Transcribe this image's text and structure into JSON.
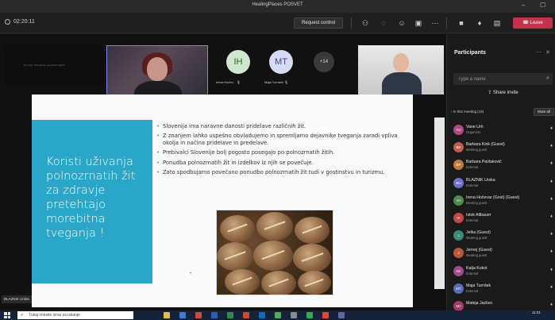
{
  "window": {
    "title": "HealingPlaces POSVET"
  },
  "toolbar": {
    "timer": "02:20:11",
    "request_control": "Request control",
    "leave": "Leave",
    "icons": [
      "people-icon",
      "chat-icon",
      "reactions-icon",
      "rooms-icon",
      "more-icon",
      "camera-icon",
      "mic-icon",
      "share-icon",
      "phone-icon"
    ]
  },
  "strip": {
    "share_caption": "Koristi uživanje polnozrnatih",
    "avatars": [
      {
        "initials": "IH",
        "label": "Irena Hočev..."
      },
      {
        "initials": "MT",
        "label": "Maja Turnšek"
      }
    ],
    "more_count": "+14"
  },
  "slide": {
    "heading": "Koristi uživanja polnozrnatih žit za zdravje pretehtajo morebitna tveganja !",
    "bullets": [
      "Slovenija ima naravne danosti pridelave različnih žit.",
      "Z znanjem lahko uspešno obvladujemo in spremljamo dejavnike tveganja zaradi vpliva okolja in načina pridelave in predelave.",
      "Prebivalci Slovenije bolj pogosto posegajo po polnozrnatih žitih.",
      "Ponudba polnozrnatih žit in izdelkov iz njih se povečuje.",
      "Zato spodbujamo povečano ponudbo polnozrnatih žit tudi v gostinstvu in turizmu."
    ],
    "stray_bullet": "•"
  },
  "presenter_tag": "BLAZNIK Urska",
  "participants": {
    "title": "Participants",
    "search_placeholder": "Type a name",
    "share_invite": "Share invite",
    "in_meeting": "In this meeting (19)",
    "mute_all": "Mute all",
    "people": [
      {
        "initials": "VU",
        "name": "Vane Urh",
        "role": "Organizer",
        "color": "#b24782"
      },
      {
        "initials": "BK",
        "name": "Barbara Kink (Guest)",
        "role": "Meeting guest",
        "color": "#c05b4d"
      },
      {
        "initials": "BP",
        "name": "Barbara Pavlakovič",
        "role": "External",
        "color": "#c27a3a"
      },
      {
        "initials": "BU",
        "name": "BLAZNIK Urska",
        "role": "External",
        "color": "#6c72c9"
      },
      {
        "initials": "IH",
        "name": "Irena Hočevar (Gost) (Guest)",
        "role": "Meeting guest",
        "color": "#4f8a4f"
      },
      {
        "initials": "IA",
        "name": "Istok Altbauer",
        "role": "External",
        "color": "#c04a4a"
      },
      {
        "initials": "J",
        "name": "Jelka (Guest)",
        "role": "Meeting guest",
        "color": "#3a8a7a"
      },
      {
        "initials": "J",
        "name": "Jernej (Guest)",
        "role": "Meeting guest",
        "color": "#b85a3a"
      },
      {
        "initials": "KK",
        "name": "Katja Kokot",
        "role": "External",
        "color": "#a04a8a"
      },
      {
        "initials": "MT",
        "name": "Maja Turnšek",
        "role": "External",
        "color": "#5a6ab8"
      },
      {
        "initials": "MJ",
        "name": "Mateja Jazbec",
        "role": "",
        "color": "#a23a6a"
      }
    ]
  },
  "taskbar": {
    "search_placeholder": "Tukaj vnesite izraz za iskanje",
    "time": "11:01"
  }
}
